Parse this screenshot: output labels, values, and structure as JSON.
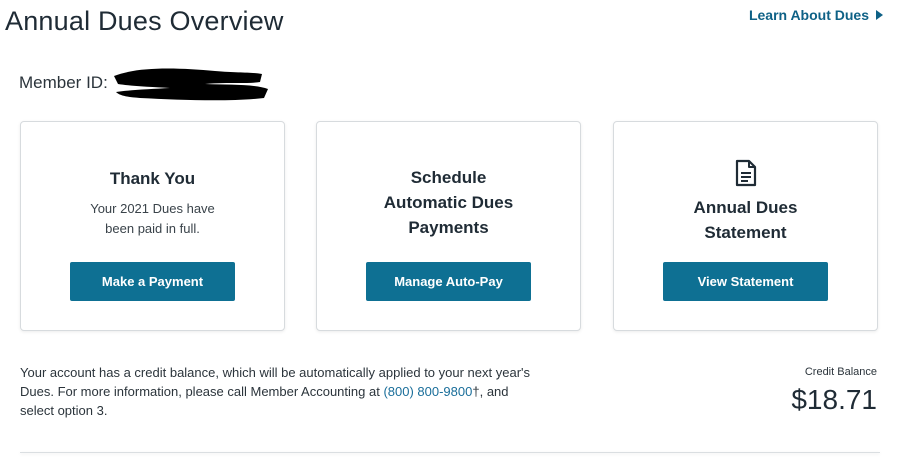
{
  "header": {
    "title": "Annual Dues Overview",
    "learn_link": "Learn About Dues"
  },
  "member": {
    "label": "Member ID:"
  },
  "cards": [
    {
      "title": "Thank You",
      "description": "Your 2021 Dues have been paid in full.",
      "button": "Make a Payment"
    },
    {
      "title": "Schedule Automatic Dues Payments",
      "button": "Manage Auto-Pay"
    },
    {
      "title": "Annual Dues Statement",
      "icon": "document-icon",
      "button": "View Statement"
    }
  ],
  "info": {
    "text_before": "Your account has a credit balance, which will be automatically applied to your next year's Dues. For more information, please call Member Accounting at ",
    "phone": "(800) 800-9800",
    "text_after": "†, and select option 3."
  },
  "credit": {
    "label": "Credit Balance",
    "value": "$18.71"
  },
  "colors": {
    "button": "#0e7093",
    "link": "#0e6186"
  }
}
